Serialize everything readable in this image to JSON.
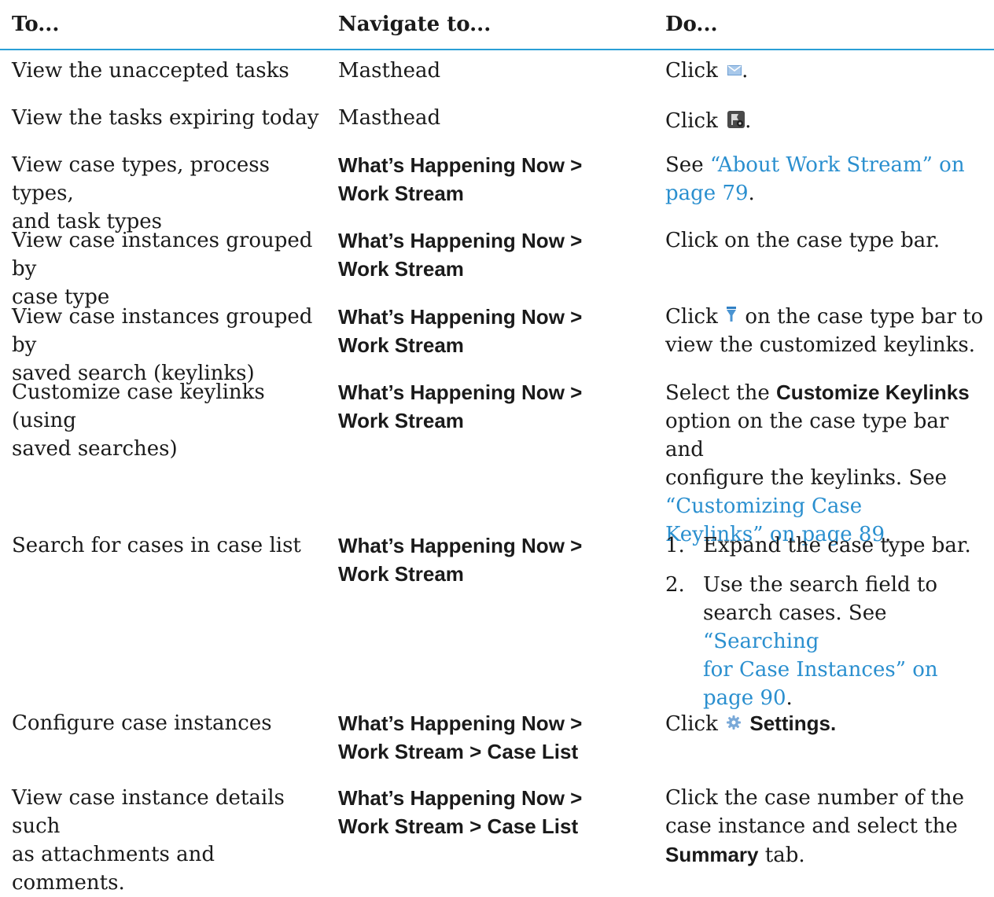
{
  "headers": {
    "to": "To...",
    "navigate": "Navigate to...",
    "do": "Do..."
  },
  "rows": [
    {
      "to": "View the unaccepted tasks",
      "nav": "Masthead",
      "do_prefix": "Click",
      "do_suffix": "."
    },
    {
      "to": "View the tasks expiring today",
      "nav": "Masthead",
      "do_prefix": "Click",
      "do_suffix": "."
    },
    {
      "to_l1": "View case types, process types,",
      "to_l2": "and task types",
      "nav_l1": "What’s Happening Now >",
      "nav_l2": "Work Stream",
      "do_prefix": "See",
      "link_l1": "“About Work Stream” on",
      "link_l2": "page 79",
      "do_suffix": "."
    },
    {
      "to_l1": "View case instances grouped by",
      "to_l2": "case type",
      "nav_l1": "What’s Happening Now >",
      "nav_l2": "Work Stream",
      "do": "Click on the case type bar."
    },
    {
      "to_l1": "View case instances grouped by",
      "to_l2": "saved search (keylinks)",
      "nav_l1": "What’s Happening Now >",
      "nav_l2": "Work Stream",
      "do_prefix": "Click",
      "do_l1_rest": "on the case type bar to",
      "do_l2": "view the customized keylinks."
    },
    {
      "to_l1": "Customize case keylinks (using",
      "to_l2": "saved searches)",
      "nav_l1": "What’s Happening Now >",
      "nav_l2": "Work Stream",
      "do_l1_prefix": "Select the",
      "do_bold": "Customize Keylinks",
      "do_l2": "option on the case type bar and",
      "do_l3": "configure the keylinks. See",
      "link_l1": "“Customizing Case",
      "link_l2": "Keylinks” on page 89",
      "do_suffix": "."
    },
    {
      "to": "Search for cases in case list",
      "nav_l1": "What’s Happening Now >",
      "nav_l2": "Work Stream",
      "steps": [
        {
          "num": "1.",
          "text": "Expand the case type bar."
        },
        {
          "num": "2.",
          "l1": "Use the search field to",
          "l2_prefix": "search cases. See",
          "link_l1": "“Searching",
          "link_l2": "for Case Instances” on",
          "link_l3": "page 90",
          "suffix": "."
        }
      ]
    },
    {
      "to": "Configure case instances",
      "nav_l1": "What’s Happening Now >",
      "nav_l2": "Work Stream > Case List",
      "do_prefix": "Click",
      "do_bold": "Settings."
    },
    {
      "to_l1": "View case instance details such",
      "to_l2": "as attachments and comments.",
      "nav_l1": "What’s Happening Now >",
      "nav_l2": "Work Stream > Case List",
      "do_l1": "Click the case number of the",
      "do_l2": "case instance and select the",
      "do_bold": "Summary",
      "do_l3_suffix": "tab."
    }
  ],
  "colors": {
    "accent": "#2a9fd6",
    "link": "#2a8fcf"
  },
  "icons": [
    "envelope-icon",
    "flag-icon",
    "filter-funnel-icon",
    "gear-icon"
  ]
}
